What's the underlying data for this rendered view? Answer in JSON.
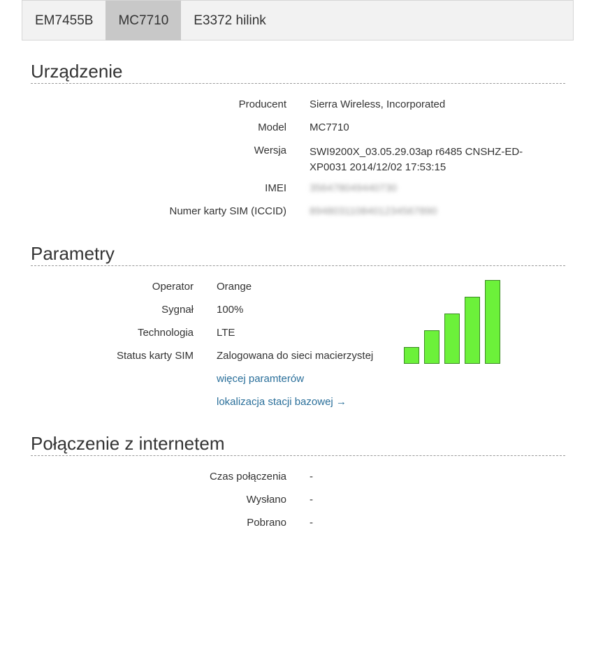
{
  "tabs": [
    {
      "label": "EM7455B",
      "active": false
    },
    {
      "label": "MC7710",
      "active": true
    },
    {
      "label": "E3372 hilink",
      "active": false
    }
  ],
  "device": {
    "title": "Urządzenie",
    "producent_label": "Producent",
    "producent_value": "Sierra Wireless, Incorporated",
    "model_label": "Model",
    "model_value": "MC7710",
    "version_label": "Wersja",
    "version_value_line1": "SWI9200X_03.05.29.03ap r6485 CNSHZ-ED-",
    "version_value_line2": "XP0031 2014/12/02 17:53:15",
    "imei_label": "IMEI",
    "imei_value": "356478049440730",
    "iccid_label": "Numer karty SIM (ICCID)",
    "iccid_value": "8948031108401234567890"
  },
  "params": {
    "title": "Parametry",
    "operator_label": "Operator",
    "operator_value": "Orange",
    "signal_label": "Sygnał",
    "signal_value": "100%",
    "signal_level": 1.0,
    "signal_bar_color": "#6cf13a",
    "technology_label": "Technologia",
    "technology_value": "LTE",
    "sim_status_label": "Status karty SIM",
    "sim_status_value": "Zalogowana do sieci macierzystej",
    "more_params_link": "więcej paramterów",
    "bts_location_link": "lokalizacja stacji bazowej →"
  },
  "connection": {
    "title": "Połączenie z internetem",
    "time_label": "Czas połączenia",
    "time_value": "-",
    "sent_label": "Wysłano",
    "sent_value": "-",
    "received_label": "Pobrano",
    "received_value": "-"
  }
}
